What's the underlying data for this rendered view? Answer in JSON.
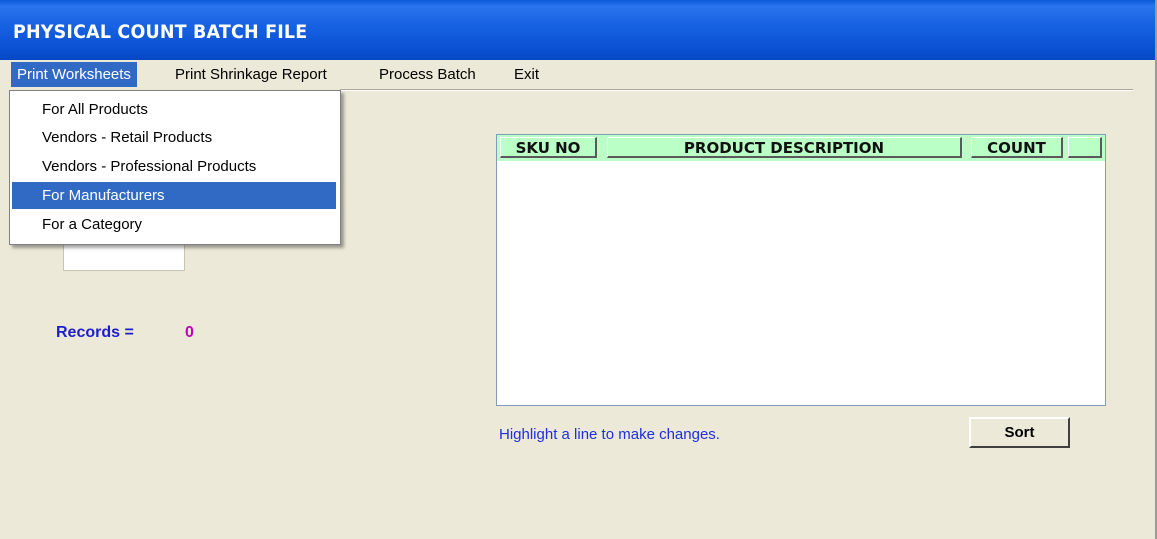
{
  "window": {
    "title": "PHYSICAL COUNT BATCH FILE"
  },
  "menubar": {
    "items": [
      {
        "label": "Print Worksheets"
      },
      {
        "label": "Print Shrinkage Report"
      },
      {
        "label": "Process Batch"
      },
      {
        "label": "Exit"
      }
    ]
  },
  "dropdown": {
    "items": [
      {
        "label": "For All Products"
      },
      {
        "label": "Vendors - Retail Products"
      },
      {
        "label": "Vendors - Professional Products"
      },
      {
        "label": "For Manufacturers"
      },
      {
        "label": "For a Category"
      }
    ],
    "selected_index": 3
  },
  "records": {
    "label": "Records =",
    "count": "0"
  },
  "list": {
    "columns": [
      {
        "label": "SKU NO"
      },
      {
        "label": "PRODUCT DESCRIPTION"
      },
      {
        "label": "COUNT"
      },
      {
        "label": ""
      }
    ],
    "rows": []
  },
  "hint": "Highlight a line to make changes.",
  "sort_button": "Sort",
  "colors": {
    "titlebar": "#0a5ad8",
    "menu_highlight": "#316ac5",
    "list_header": "#b9ffc6",
    "records_label": "#1e1ecc",
    "records_count": "#c000c0",
    "hint_text": "#1e2ee0"
  }
}
